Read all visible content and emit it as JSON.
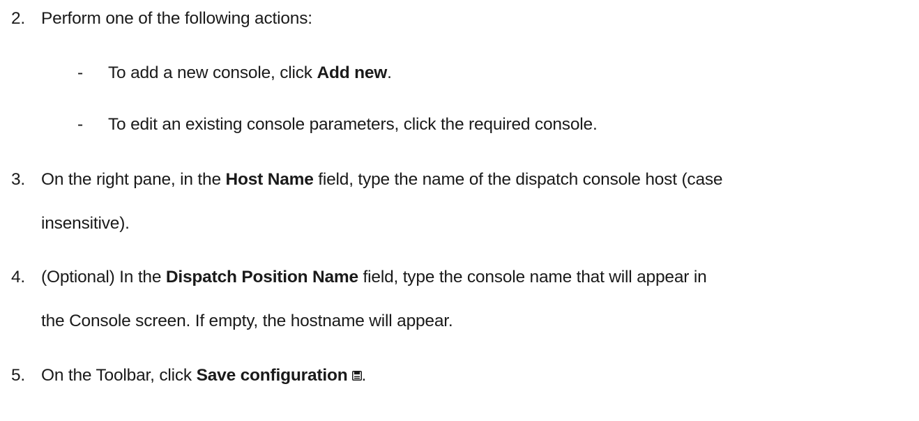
{
  "steps": [
    {
      "number": "2.",
      "text": "Perform one of the following actions:"
    },
    {
      "number": "3.",
      "pre": "On the right pane, in the ",
      "bold": "Host Name",
      "post": " field, type the name of the dispatch console host (case",
      "cont": "insensitive)."
    },
    {
      "number": "4.",
      "pre": "(Optional) In the ",
      "bold": "Dispatch Position Name",
      "post": " field, type the console name that will appear in",
      "cont": "the Console screen. If empty, the hostname will appear."
    },
    {
      "number": "5.",
      "pre": "On the Toolbar, click ",
      "bold": "Save configuration",
      "post": ".",
      "icon": "save-icon"
    }
  ],
  "sub_items": [
    {
      "dash": "-",
      "pre": "To add a new console, click ",
      "bold": "Add new",
      "post": "."
    },
    {
      "dash": "-",
      "text": "To edit an existing console parameters, click the required console."
    }
  ]
}
